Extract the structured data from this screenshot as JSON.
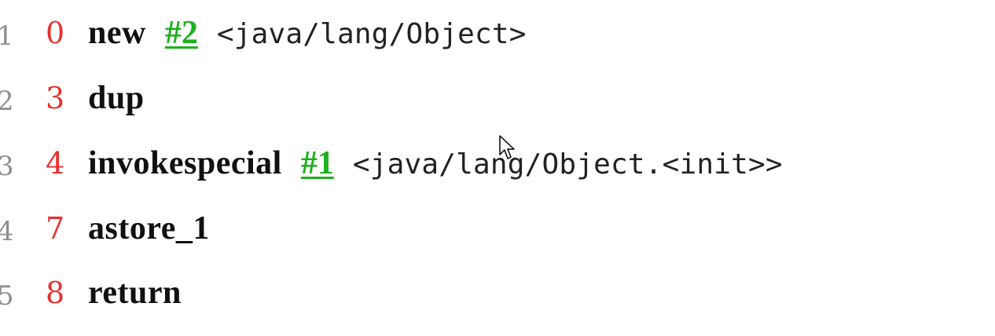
{
  "lines": [
    {
      "number": "1",
      "offset": "0",
      "opcode": "new",
      "cpref": "#2",
      "comment": "<java/lang/Object>"
    },
    {
      "number": "2",
      "offset": "3",
      "opcode": "dup"
    },
    {
      "number": "3",
      "offset": "4",
      "opcode": "invokespecial",
      "cpref": "#1",
      "comment": "<java/lang/Object.<init>>"
    },
    {
      "number": "4",
      "offset": "7",
      "opcode": "astore_1"
    },
    {
      "number": "5",
      "offset": "8",
      "opcode": "return"
    }
  ],
  "colors": {
    "offset": "#e8302e",
    "cpref": "#1eb01e",
    "line_number": "#8f8f8f",
    "opcode": "#111111"
  },
  "icons": {
    "cursor": "mouse-pointer-icon"
  }
}
